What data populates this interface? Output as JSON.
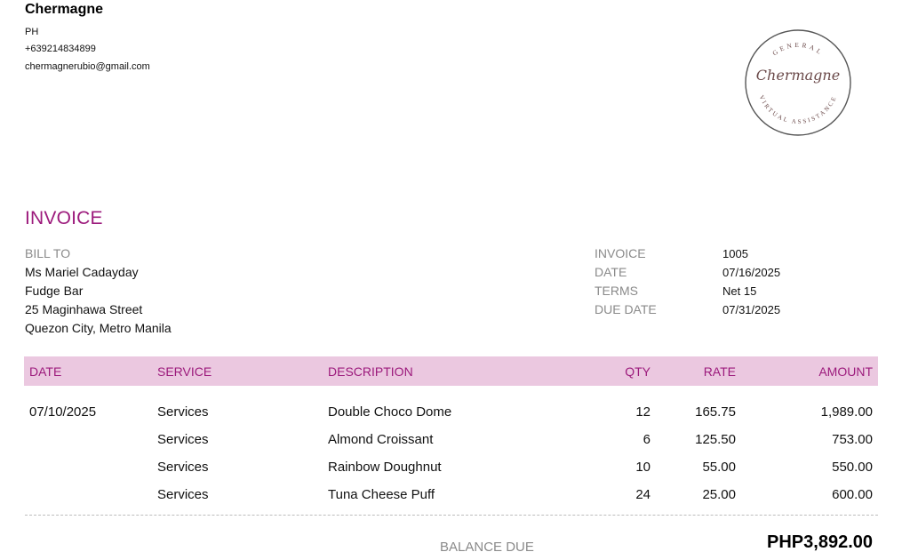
{
  "company": {
    "name": "Chermagne",
    "country": "PH",
    "phone": "+639214834899",
    "email": "chermagnerubio@gmail.com"
  },
  "logo": {
    "ring_top": "GENERAL",
    "script": "Chermagne",
    "ring_bottom": "VIRTUAL ASSISTANCE",
    "colors": {
      "ring": "#555555",
      "text": "#6b4a4a"
    }
  },
  "invoice": {
    "title": "INVOICE"
  },
  "bill_to": {
    "label": "BILL TO",
    "lines": [
      "Ms Mariel Cadayday",
      "Fudge Bar",
      "25 Maginhawa Street",
      "Quezon City, Metro Manila"
    ]
  },
  "meta": [
    {
      "label": "INVOICE",
      "value": "1005"
    },
    {
      "label": "DATE",
      "value": "07/16/2025"
    },
    {
      "label": "TERMS",
      "value": "Net 15"
    },
    {
      "label": "DUE DATE",
      "value": "07/31/2025"
    }
  ],
  "table": {
    "headers": [
      "DATE",
      "SERVICE",
      "DESCRIPTION",
      "QTY",
      "RATE",
      "AMOUNT"
    ],
    "rows": [
      {
        "date": "07/10/2025",
        "service": "Services",
        "description": "Double Choco Dome",
        "qty": "12",
        "rate": "165.75",
        "amount": "1,989.00"
      },
      {
        "date": "",
        "service": "Services",
        "description": "Almond Croissant",
        "qty": "6",
        "rate": "125.50",
        "amount": "753.00"
      },
      {
        "date": "",
        "service": "Services",
        "description": "Rainbow Doughnut",
        "qty": "10",
        "rate": "55.00",
        "amount": "550.00"
      },
      {
        "date": "",
        "service": "Services",
        "description": "Tuna Cheese Puff",
        "qty": "24",
        "rate": "25.00",
        "amount": "600.00"
      }
    ]
  },
  "balance": {
    "label": "BALANCE DUE",
    "value": "PHP3,892.00"
  },
  "colors": {
    "accent": "#9c1a7c",
    "header_bg": "#ebc8e0",
    "label_grey": "#8a8a8a"
  }
}
